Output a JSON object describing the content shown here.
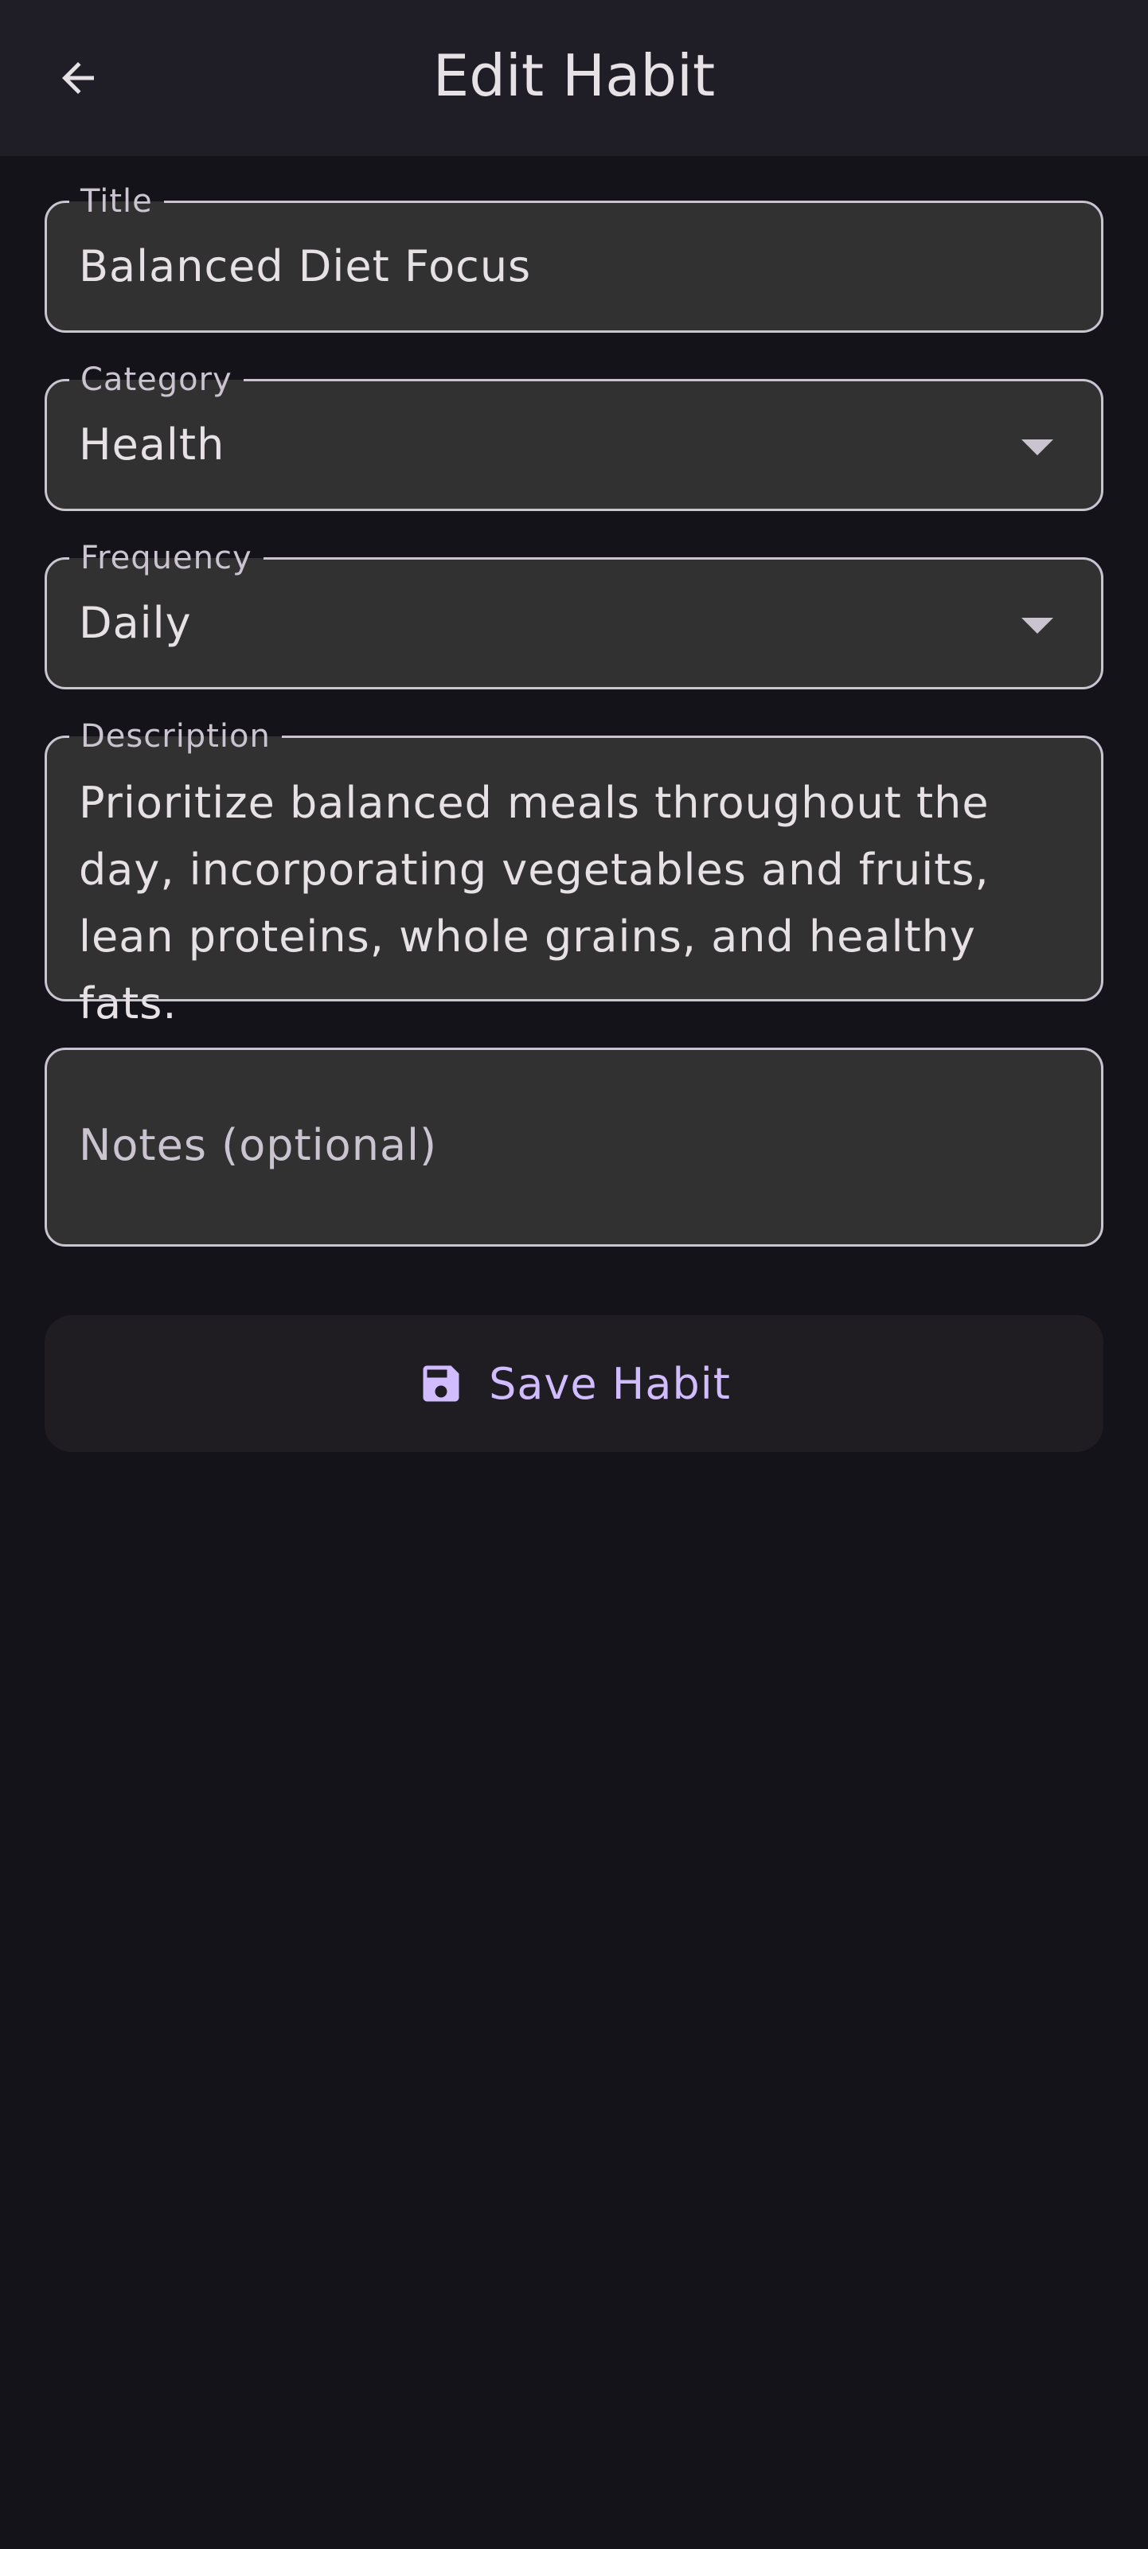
{
  "app_bar": {
    "title": "Edit Habit",
    "back_icon": "arrow-back-icon"
  },
  "form": {
    "title": {
      "label": "Title",
      "value": "Balanced Diet Focus"
    },
    "category": {
      "label": "Category",
      "value": "Health"
    },
    "frequency": {
      "label": "Frequency",
      "value": "Daily"
    },
    "description": {
      "label": "Description",
      "value": "Prioritize balanced meals throughout the day, incorporating vegetables and fruits, lean proteins, whole grains, and healthy fats."
    },
    "notes": {
      "placeholder": "Notes (optional)",
      "value": ""
    }
  },
  "save_button": {
    "label": "Save Habit",
    "icon": "save-icon"
  },
  "colors": {
    "background": "#15131a",
    "app_bar": "#1f1d26",
    "field_fill": "#323132",
    "field_border": "#c9c4cf",
    "accent": "#d0bcff"
  }
}
